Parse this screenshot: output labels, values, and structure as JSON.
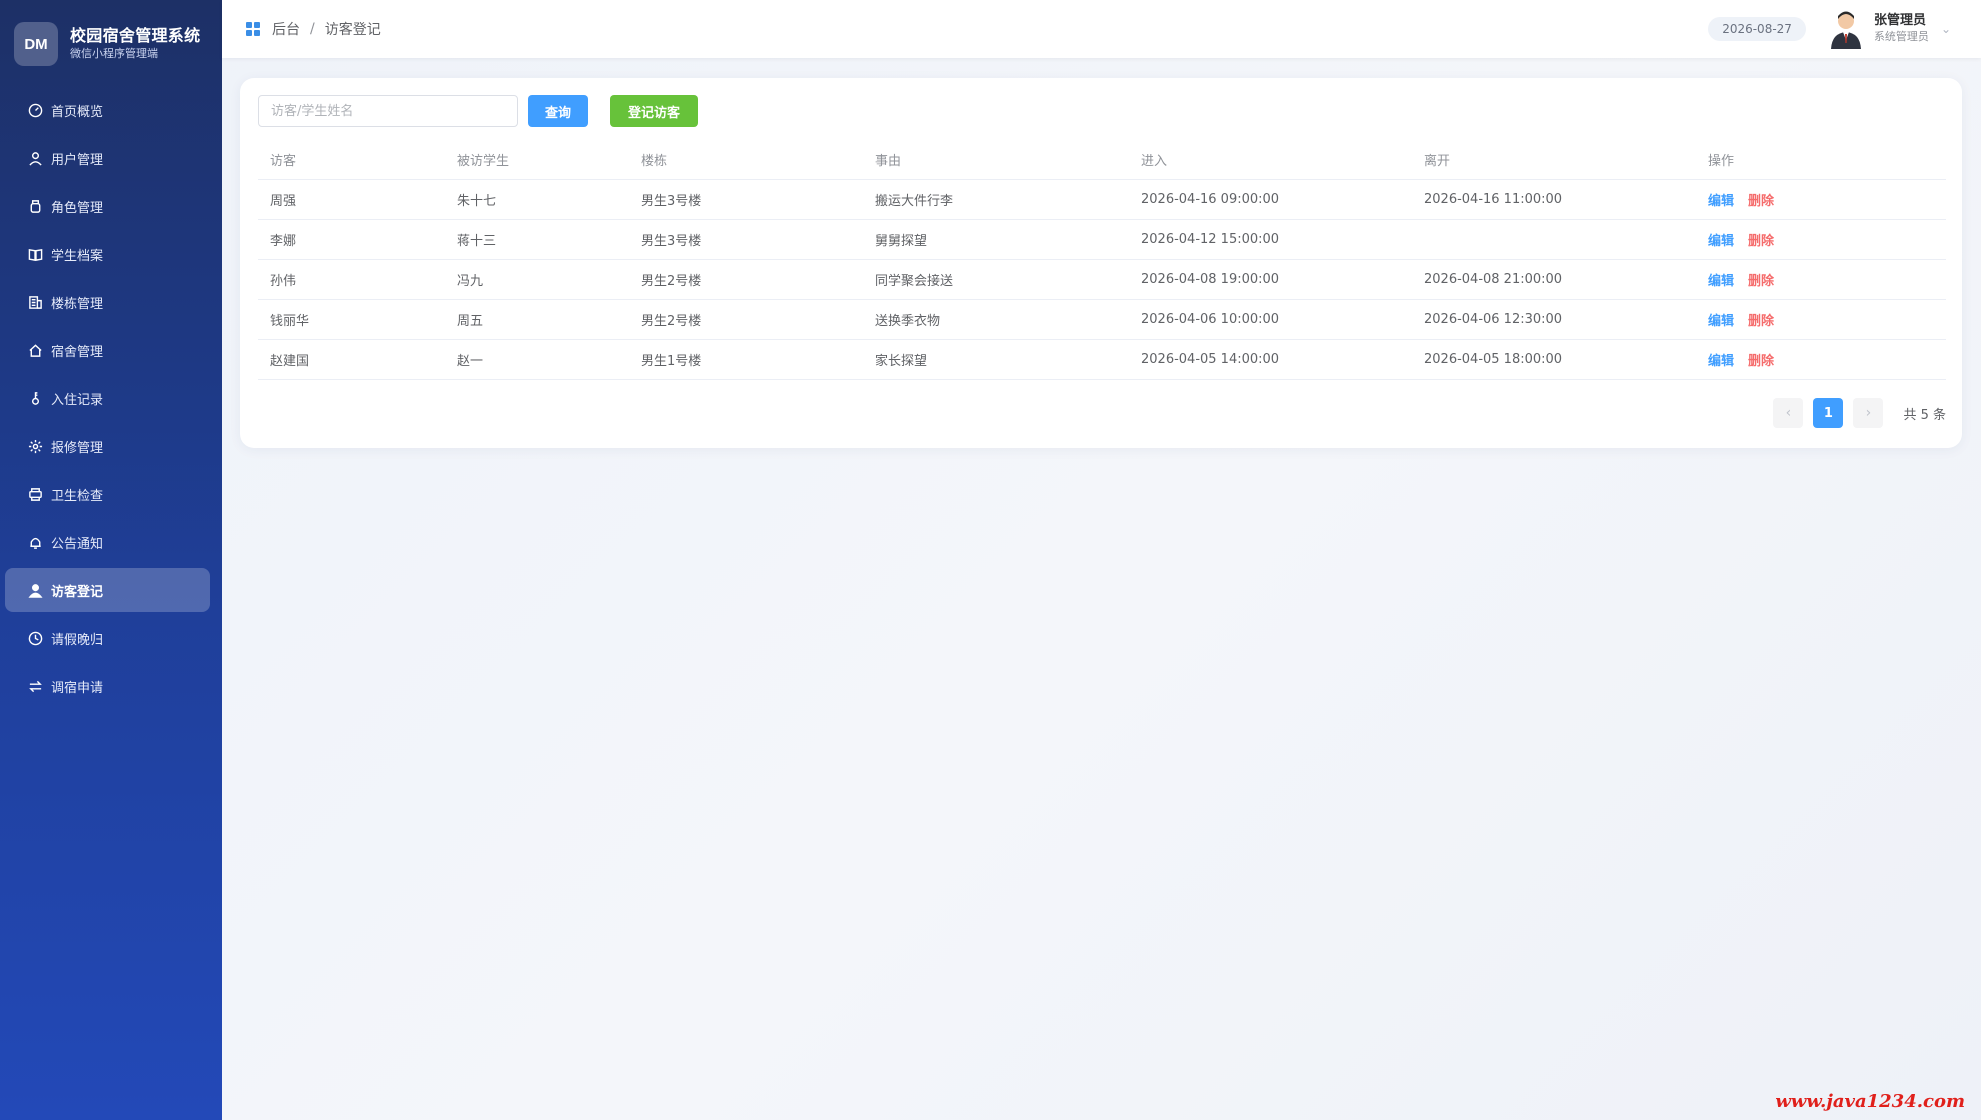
{
  "brand": {
    "logo": "DM",
    "title": "校园宿舍管理系统",
    "subtitle": "微信小程序管理端"
  },
  "menu": [
    {
      "label": "首页概览",
      "icon": "dashboard-icon"
    },
    {
      "label": "用户管理",
      "icon": "user-icon"
    },
    {
      "label": "角色管理",
      "icon": "badge-icon"
    },
    {
      "label": "学生档案",
      "icon": "book-icon"
    },
    {
      "label": "楼栋管理",
      "icon": "building-icon"
    },
    {
      "label": "宿舍管理",
      "icon": "home-icon"
    },
    {
      "label": "入住记录",
      "icon": "key-icon"
    },
    {
      "label": "报修管理",
      "icon": "gear-icon"
    },
    {
      "label": "卫生检查",
      "icon": "printer-icon"
    },
    {
      "label": "公告通知",
      "icon": "bell-icon"
    },
    {
      "label": "访客登记",
      "icon": "visitor-icon",
      "active": true
    },
    {
      "label": "请假晚归",
      "icon": "clock-icon"
    },
    {
      "label": "调宿申请",
      "icon": "swap-icon"
    }
  ],
  "header": {
    "breadcrumb_root": "后台",
    "breadcrumb_sep": "/",
    "breadcrumb_current": "访客登记",
    "date": "2026-08-27",
    "user_name": "张管理员",
    "user_role": "系统管理员"
  },
  "toolbar": {
    "search_placeholder": "访客/学生姓名",
    "query_label": "查询",
    "add_label": "登记访客"
  },
  "table": {
    "columns": [
      "访客",
      "被访学生",
      "楼栋",
      "事由",
      "进入",
      "离开",
      "操作"
    ],
    "edit_label": "编辑",
    "delete_label": "删除",
    "rows": [
      [
        "周强",
        "朱十七",
        "男生3号楼",
        "搬运大件行李",
        "2026-04-16 09:00:00",
        "2026-04-16 11:00:00"
      ],
      [
        "李娜",
        "蒋十三",
        "男生3号楼",
        "舅舅探望",
        "2026-04-12 15:00:00",
        ""
      ],
      [
        "孙伟",
        "冯九",
        "男生2号楼",
        "同学聚会接送",
        "2026-04-08 19:00:00",
        "2026-04-08 21:00:00"
      ],
      [
        "钱丽华",
        "周五",
        "男生2号楼",
        "送换季衣物",
        "2026-04-06 10:00:00",
        "2026-04-06 12:30:00"
      ],
      [
        "赵建国",
        "赵一",
        "男生1号楼",
        "家长探望",
        "2026-04-05 14:00:00",
        "2026-04-05 18:00:00"
      ]
    ]
  },
  "pagination": {
    "prev": "‹",
    "current": "1",
    "next": "›",
    "total": "共 5 条"
  },
  "watermark": "www.java1234.com",
  "colors": {
    "primary": "#409eff",
    "success": "#67c23a",
    "danger": "#f56c6c",
    "sidebar": "#1f3f9a"
  }
}
